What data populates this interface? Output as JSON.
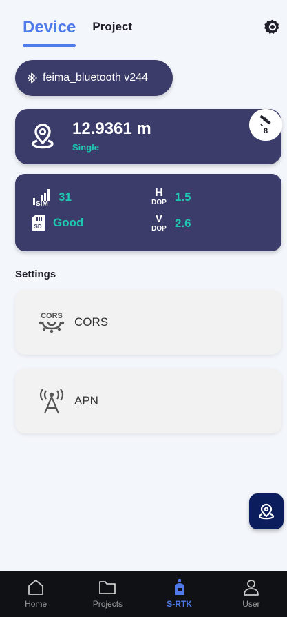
{
  "tabs": {
    "device": "Device",
    "project": "Project"
  },
  "bluetooth": {
    "label": "feima_bluetooth v244"
  },
  "position": {
    "value": "12.9361 m",
    "status": "Single",
    "satellites": "8"
  },
  "stats": {
    "sim": "31",
    "sd": "Good",
    "hdop_letter": "H",
    "hdop_word": "DOP",
    "hdop": "1.5",
    "vdop_letter": "V",
    "vdop_word": "DOP",
    "vdop": "2.6",
    "sim_tag": "SIM",
    "sd_tag": "SD"
  },
  "settings": {
    "heading": "Settings",
    "items": [
      {
        "label": "CORS",
        "icon_text": "CORS"
      },
      {
        "label": "APN"
      }
    ]
  },
  "nav": [
    {
      "label": "Home",
      "icon": "home-icon"
    },
    {
      "label": "Projects",
      "icon": "folder-icon"
    },
    {
      "label": "S-RTK",
      "icon": "rtk-device-icon"
    },
    {
      "label": "User",
      "icon": "user-icon"
    }
  ],
  "colors": {
    "accent": "#4f7bea",
    "card": "#3b3c69",
    "teal": "#1fc7b0",
    "nav_bg": "#101114",
    "fab": "#0b1d5c"
  }
}
